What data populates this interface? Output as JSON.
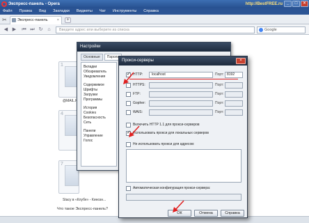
{
  "window": {
    "title": "Экспресс-панель - Opera",
    "site": "http://BestFREE.ru",
    "minimize": "_",
    "maximize": "□",
    "close": "×"
  },
  "menu": [
    "Файл",
    "Правка",
    "Вид",
    "Закладки",
    "Виджеты",
    "Чат",
    "Инструменты",
    "Справка"
  ],
  "tab": {
    "label": "Экспресс-панель",
    "close": "×",
    "new": "+"
  },
  "address": {
    "placeholder": "Введите адрес или выберите из списка",
    "search": "Google"
  },
  "content": {
    "thumbs": [
      {
        "num": "1",
        "caption": "@MAIL.R..."
      },
      {
        "num": "4",
        "caption": ""
      },
      {
        "num": "7",
        "caption": "Stacy в «Клубе» - Кинозн..."
      }
    ],
    "question": "Что такое Экспресс-панель?"
  },
  "settings": {
    "title": "Настройки",
    "tabs": [
      "Основные",
      "Пароли"
    ],
    "nav_groups": [
      [
        "Вкладки",
        "Обозреватель",
        "Уведомления"
      ],
      [
        "Содержимое",
        "Шрифты",
        "Загрузки",
        "Программы"
      ],
      [
        "История",
        "Cookies",
        "Безопасность",
        "Сеть"
      ],
      [
        "Панели",
        "Управление",
        "Голос"
      ]
    ]
  },
  "proxy": {
    "title": "Прокси-серверы",
    "close": "×",
    "port_label": "Порт:",
    "rows": [
      {
        "label": "HTTP:",
        "value": "localhost",
        "port": "8192",
        "checked": true
      },
      {
        "label": "HTTPS:",
        "value": "",
        "port": "",
        "checked": false
      },
      {
        "label": "FTP:",
        "value": "",
        "port": "",
        "checked": false
      },
      {
        "label": "Gopher:",
        "value": "",
        "port": "",
        "checked": false
      },
      {
        "label": "WAIS:",
        "value": "",
        "port": "",
        "checked": false
      }
    ],
    "enable_http11": "Включить HTTP 1.1 для прокси-серверов",
    "use_local": "Использовать прокси для локальных серверов",
    "no_proxy": "Не использовать прокси для адресов:",
    "auto_config": "Автоматическая конфигурация прокси-сервера:",
    "ok": "ОК",
    "cancel": "Отмена",
    "help": "Справка"
  },
  "colors": {
    "title_bar": "#2b5494",
    "annotation": "#e02020"
  }
}
